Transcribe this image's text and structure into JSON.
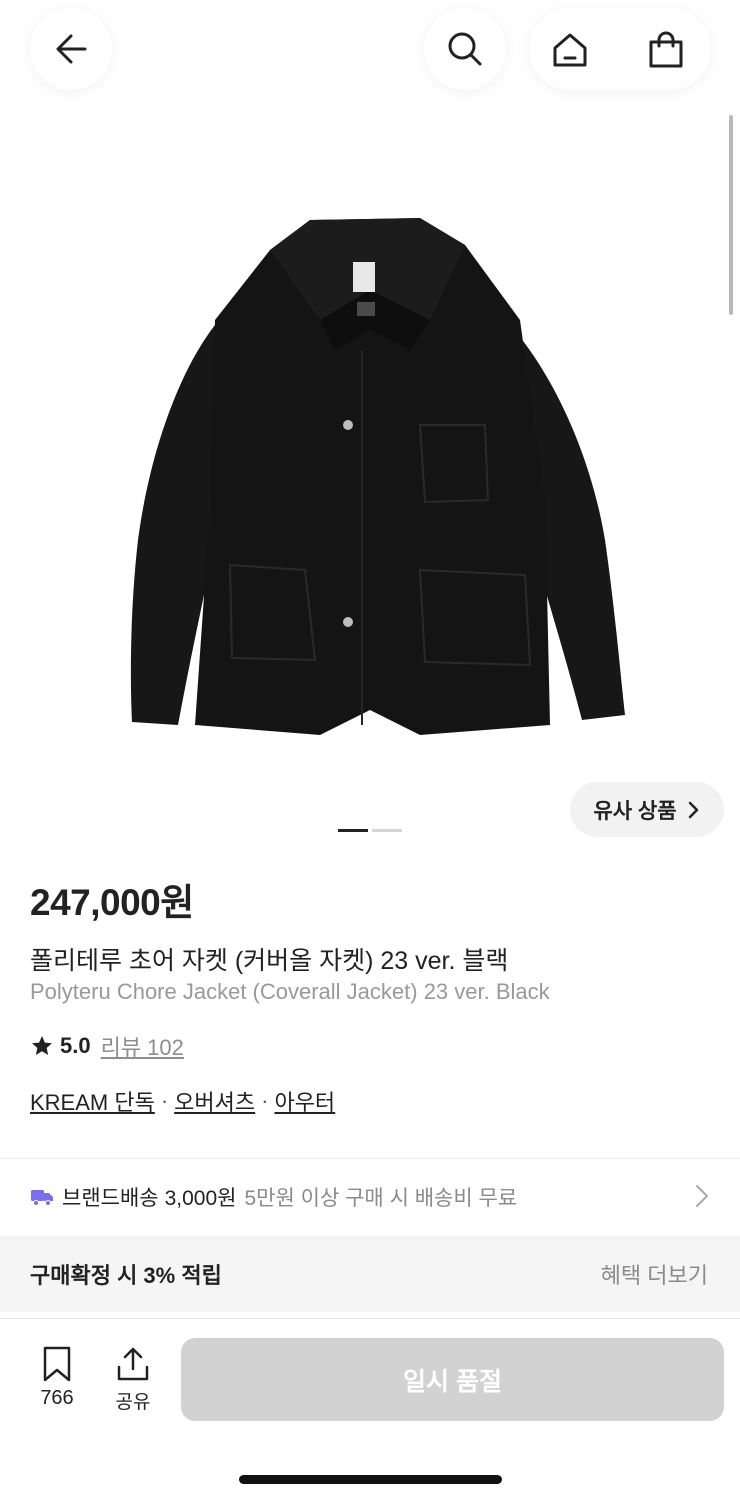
{
  "header": {
    "back_icon": "arrow-left-icon",
    "search_icon": "search-icon",
    "home_icon": "home-icon",
    "bag_icon": "shopping-bag-icon"
  },
  "similar_products": {
    "label": "유사 상품"
  },
  "carousel": {
    "current": 1,
    "total": 2
  },
  "product": {
    "price": "247,000원",
    "title_ko": "폴리테루 초어 자켓 (커버올 자켓) 23 ver. 블랙",
    "title_en": "Polyteru Chore Jacket (Coverall Jacket) 23 ver. Black",
    "rating": "5.0",
    "review_label": "리뷰 102",
    "tags": [
      "KREAM 단독",
      "오버셔츠",
      "아우터"
    ]
  },
  "shipping": {
    "label": "브랜드배송",
    "fee": "3,000원",
    "note": "5만원 이상 구매 시 배송비 무료",
    "color": "#7b6ff0"
  },
  "benefit": {
    "text": "구매확정 시 3% 적립",
    "more": "혜택 더보기"
  },
  "bottom_bar": {
    "bookmark_count": "766",
    "share_label": "공유",
    "action_label": "일시 품절"
  }
}
